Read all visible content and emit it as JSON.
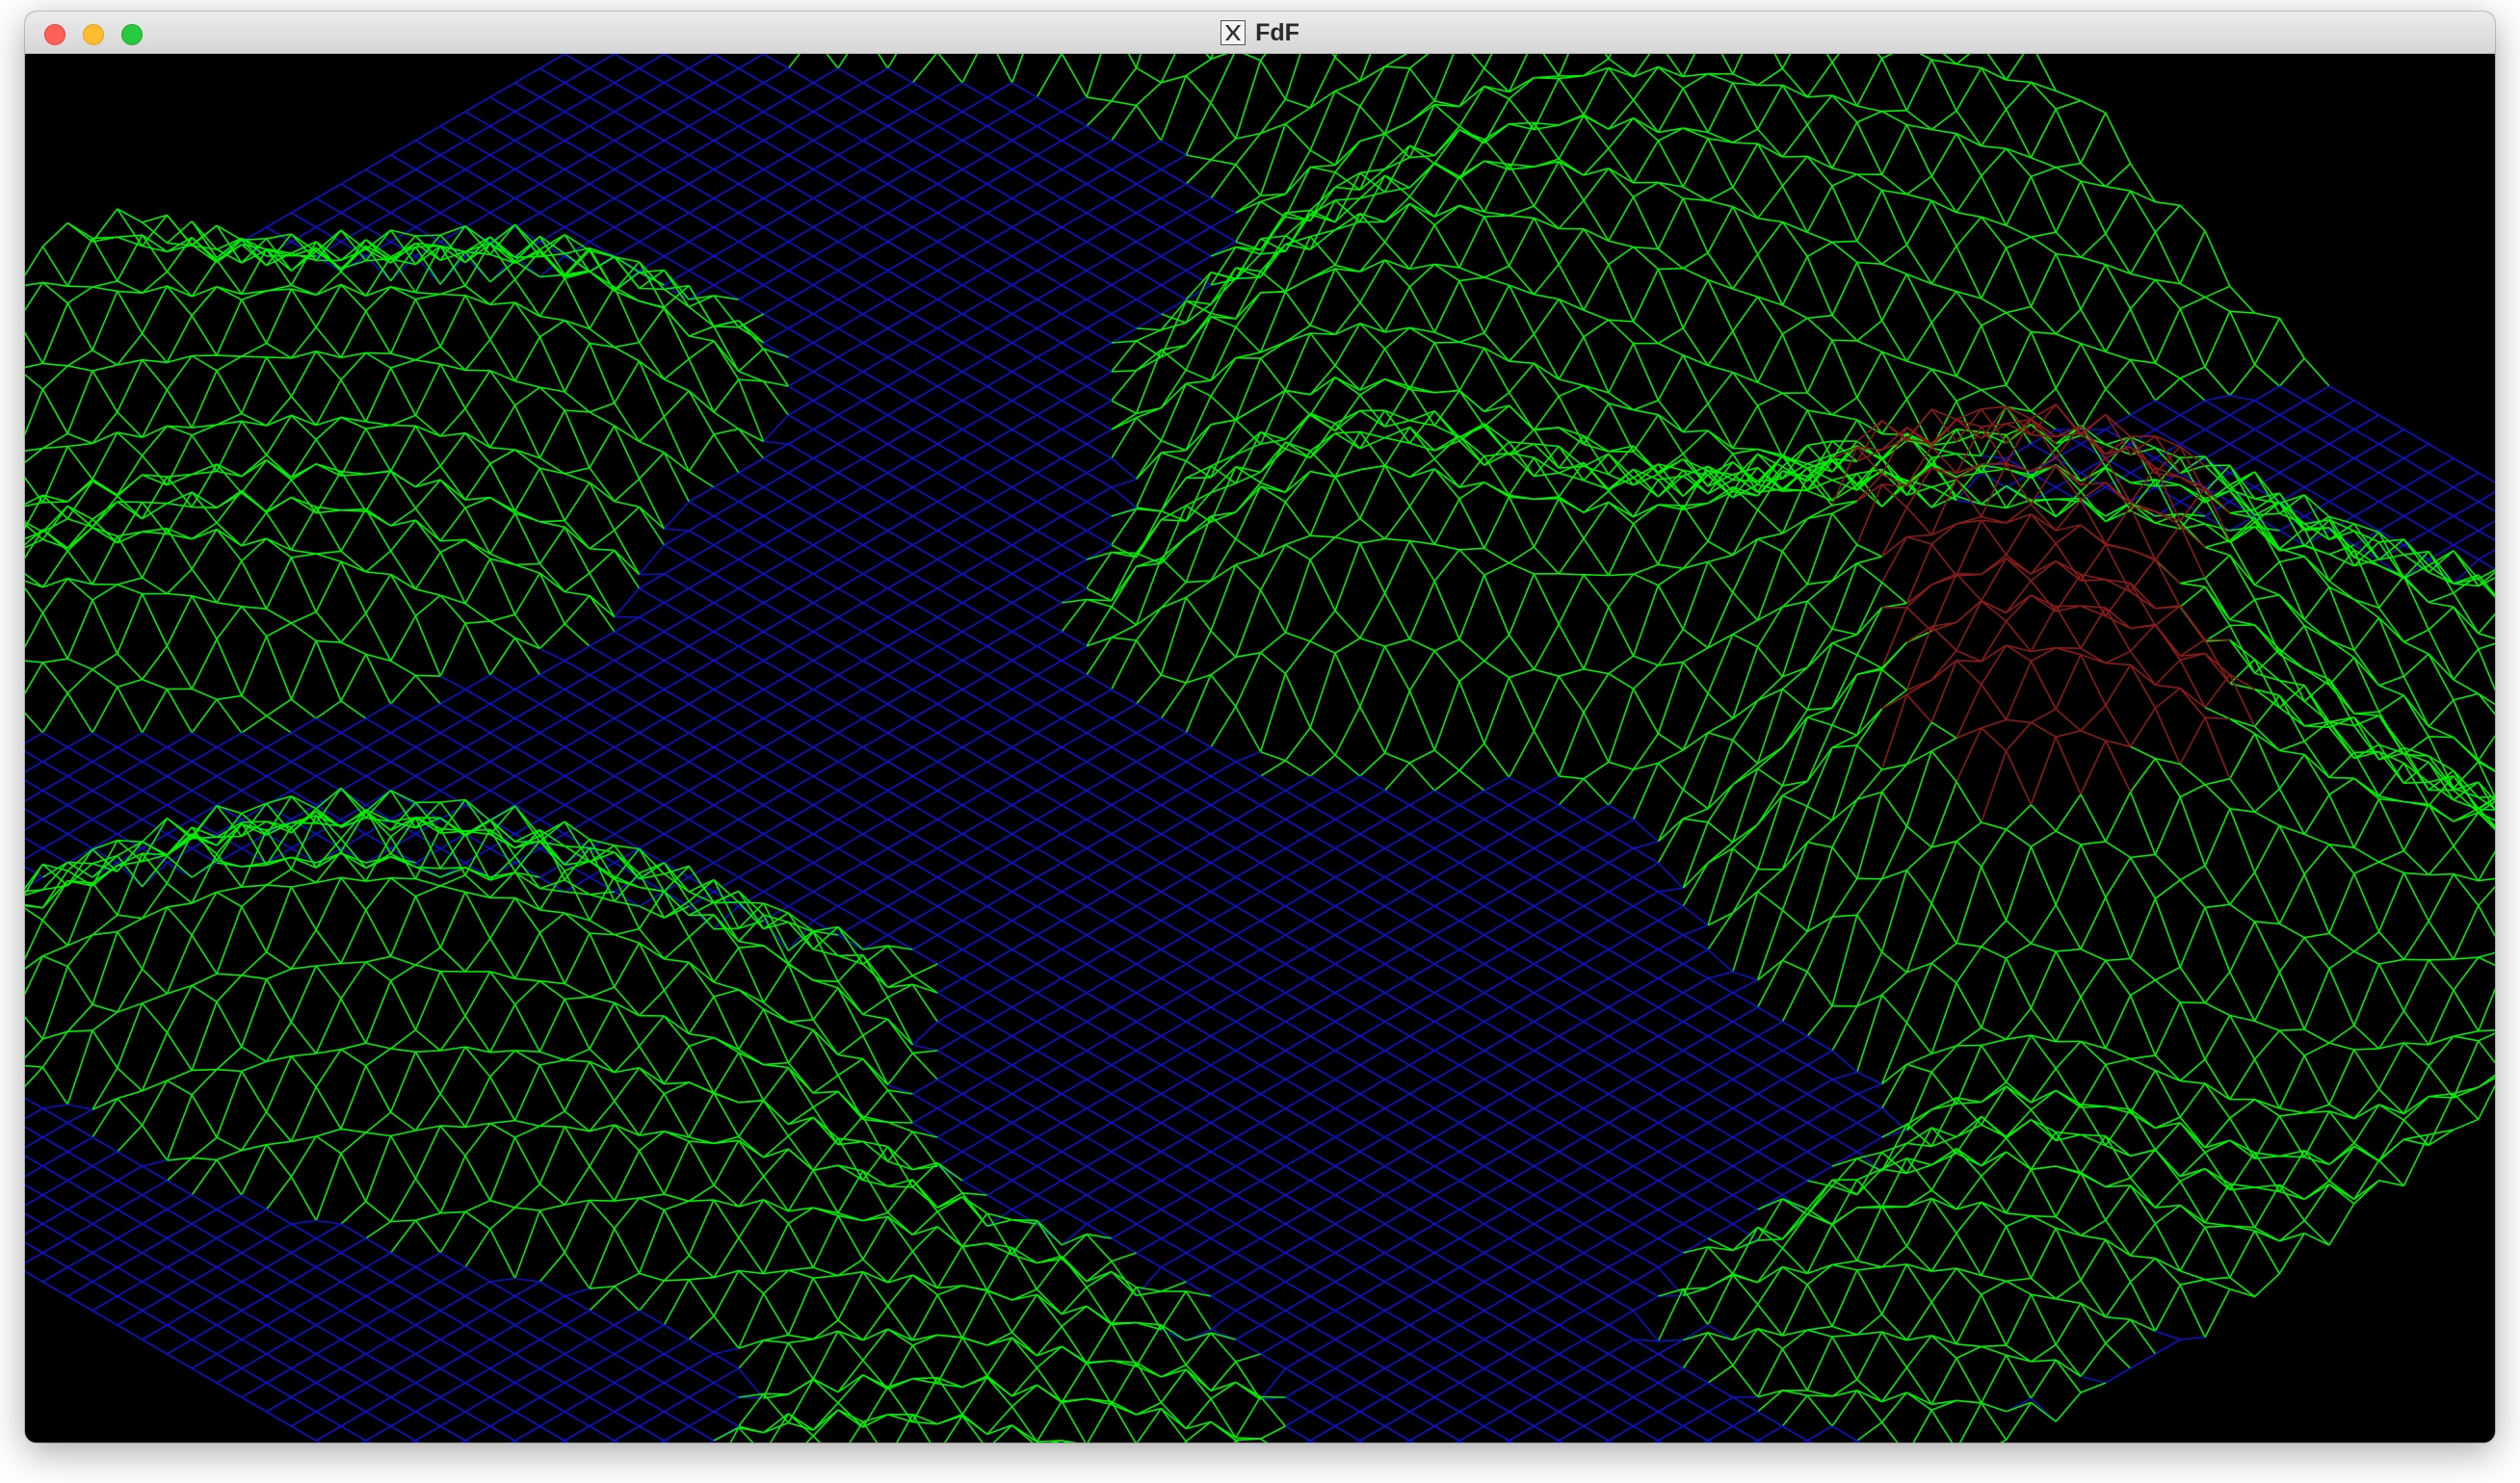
{
  "window": {
    "title": "FdF"
  },
  "render": {
    "background": "#000000",
    "low_color": "#1010c8",
    "mid_color": "#00f000",
    "high_color": "#8b1a1a"
  },
  "icons": {
    "app_icon": "x11-icon"
  }
}
